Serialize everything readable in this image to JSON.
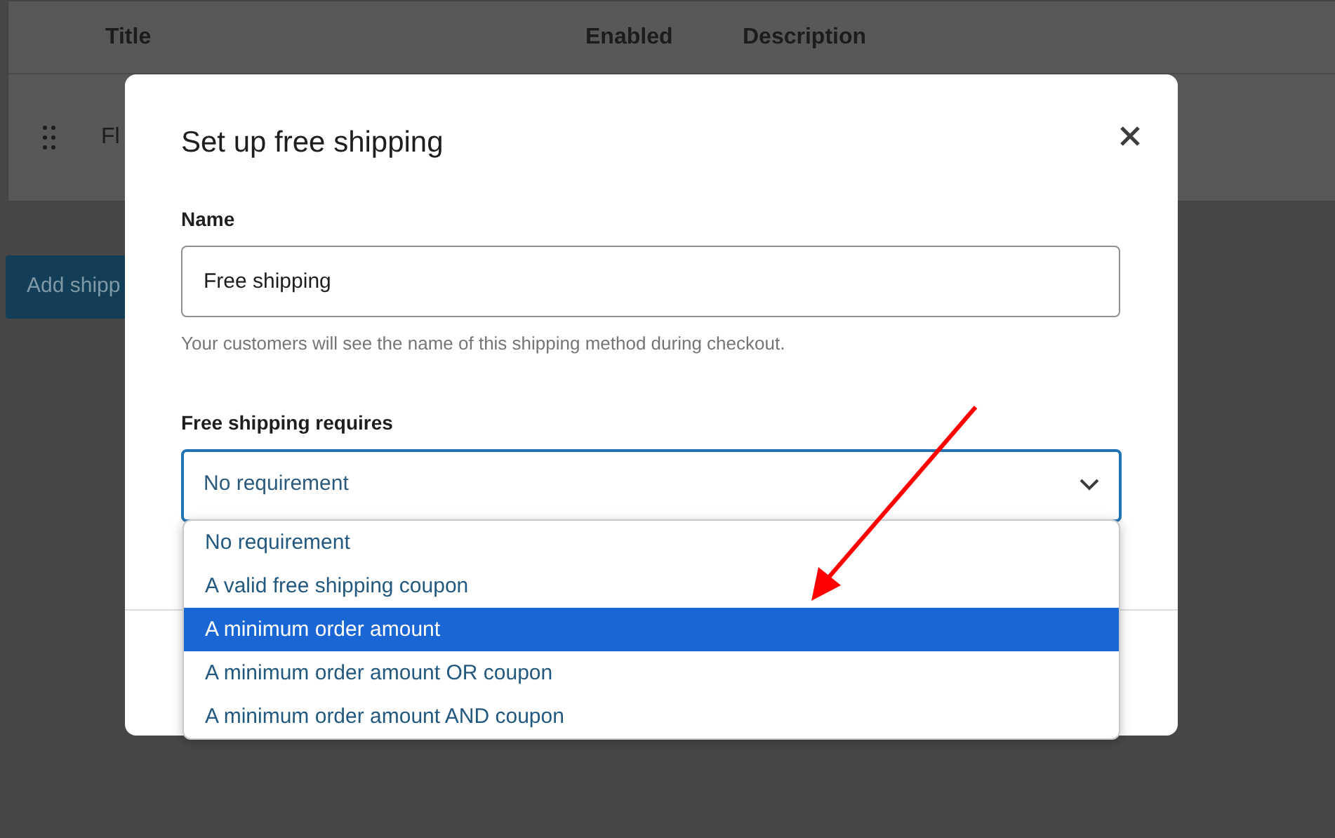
{
  "table": {
    "columns": [
      "Title",
      "Enabled",
      "Description"
    ],
    "rows": [
      {
        "title": "Fl"
      }
    ]
  },
  "add_button": "Add shipp",
  "modal": {
    "title": "Set up free shipping",
    "name_label": "Name",
    "name_value": "Free shipping",
    "name_help": "Your customers will see the name of this shipping method during checkout.",
    "requires_label": "Free shipping requires",
    "requires_value": "No requirement",
    "options": [
      {
        "label": "No requirement",
        "selected": false
      },
      {
        "label": "A valid free shipping coupon",
        "selected": false
      },
      {
        "label": "A minimum order amount",
        "selected": true
      },
      {
        "label": "A minimum order amount OR coupon",
        "selected": false
      },
      {
        "label": "A minimum order amount AND coupon",
        "selected": false
      }
    ]
  }
}
